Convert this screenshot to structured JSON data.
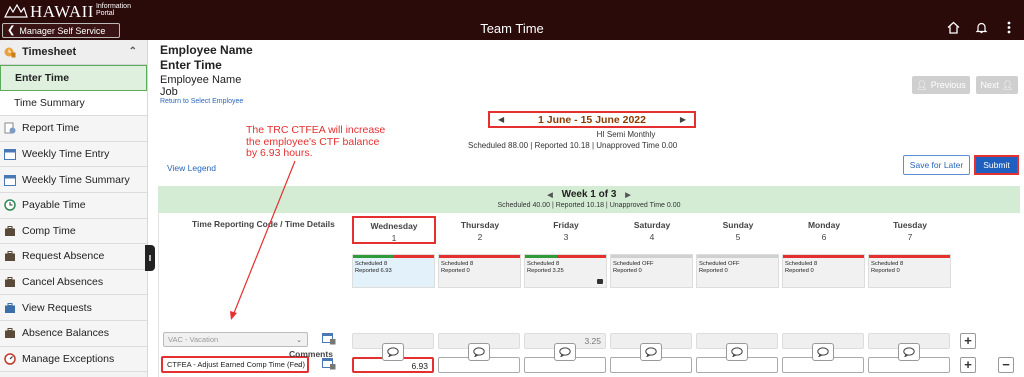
{
  "header": {
    "logo_main": "HAWAII",
    "logo_sub_1": "Information",
    "logo_sub_2": "Portal",
    "back_button": "Manager Self Service",
    "title": "Team Time"
  },
  "sidebar": {
    "section": "Timesheet",
    "items": [
      {
        "label": "Enter Time",
        "icon": "none"
      },
      {
        "label": "Time Summary",
        "icon": "none"
      },
      {
        "label": "Report Time",
        "icon": "report-icon"
      },
      {
        "label": "Weekly Time Entry",
        "icon": "calendar-icon"
      },
      {
        "label": "Weekly Time Summary",
        "icon": "calendar-icon"
      },
      {
        "label": "Payable Time",
        "icon": "clock-icon"
      },
      {
        "label": "Comp Time",
        "icon": "briefcase-icon"
      },
      {
        "label": "Request Absence",
        "icon": "briefcase-icon"
      },
      {
        "label": "Cancel Absences",
        "icon": "briefcase-icon"
      },
      {
        "label": "View Requests",
        "icon": "briefcase-icon"
      },
      {
        "label": "Absence Balances",
        "icon": "briefcase-icon"
      },
      {
        "label": "Manage Exceptions",
        "icon": "gauge-icon"
      }
    ]
  },
  "employee": {
    "name_title": "Employee Name",
    "page_heading": "Enter Time",
    "name": "Employee Name",
    "job": "Job",
    "return_link": "Return to Select Employee"
  },
  "nav": {
    "previous": "Previous",
    "next": "Next"
  },
  "period": {
    "range": "1 June - 15 June 2022",
    "type": "HI Semi Monthly",
    "summary": "Scheduled  88.00 | Reported  10.18 | Unapproved Time  0.00"
  },
  "actions": {
    "view_legend": "View Legend",
    "save_for_later": "Save for Later",
    "submit": "Submit"
  },
  "annotation": {
    "line1": "The TRC CTFEA will increase",
    "line2": "the employee's CTF balance",
    "line3": "by 6.93 hours."
  },
  "week": {
    "title": "Week 1 of 3",
    "summary": "Scheduled  40.00 | Reported  10.18 | Unapproved Time  0.00"
  },
  "grid": {
    "trc_header": "Time Reporting Code / Time Details",
    "days": [
      {
        "name": "Wednesday",
        "num": "1",
        "sched": "Scheduled 8",
        "rep": "Reported  6.93",
        "bar": [
          "#2e9a3a",
          "#e53030"
        ],
        "split": 0.5
      },
      {
        "name": "Thursday",
        "num": "2",
        "sched": "Scheduled 8",
        "rep": "Reported  0",
        "bar": [
          "#e53030"
        ],
        "split": 1
      },
      {
        "name": "Friday",
        "num": "3",
        "sched": "Scheduled 8",
        "rep": "Reported  3.25",
        "bar": [
          "#2e9a3a",
          "#e53030"
        ],
        "split": 0.4
      },
      {
        "name": "Saturday",
        "num": "4",
        "sched": "Scheduled OFF",
        "rep": "Reported  0",
        "bar": [
          "#d0d0d0"
        ],
        "split": 1
      },
      {
        "name": "Sunday",
        "num": "5",
        "sched": "Scheduled OFF",
        "rep": "Reported  0",
        "bar": [
          "#d0d0d0"
        ],
        "split": 1
      },
      {
        "name": "Monday",
        "num": "6",
        "sched": "Scheduled 8",
        "rep": "Reported  0",
        "bar": [
          "#e53030"
        ],
        "split": 1
      },
      {
        "name": "Tuesday",
        "num": "7",
        "sched": "Scheduled 8",
        "rep": "Reported  0",
        "bar": [
          "#e53030"
        ],
        "split": 1
      }
    ],
    "rows": [
      {
        "trc": "VAC - Vacation",
        "values": [
          "",
          "",
          "3.25",
          "",
          "",
          "",
          ""
        ]
      },
      {
        "trc": "CTFEA - Adjust Earned Comp Time (Fed)",
        "values": [
          "6.93",
          "",
          "",
          "",
          "",
          "",
          ""
        ]
      }
    ],
    "comments_label": "Comments"
  },
  "colors": {
    "header_bg": "#2b0a0a",
    "accent_red": "#e53030",
    "week_band": "#d4ecd4",
    "submit": "#1f5fbf"
  }
}
